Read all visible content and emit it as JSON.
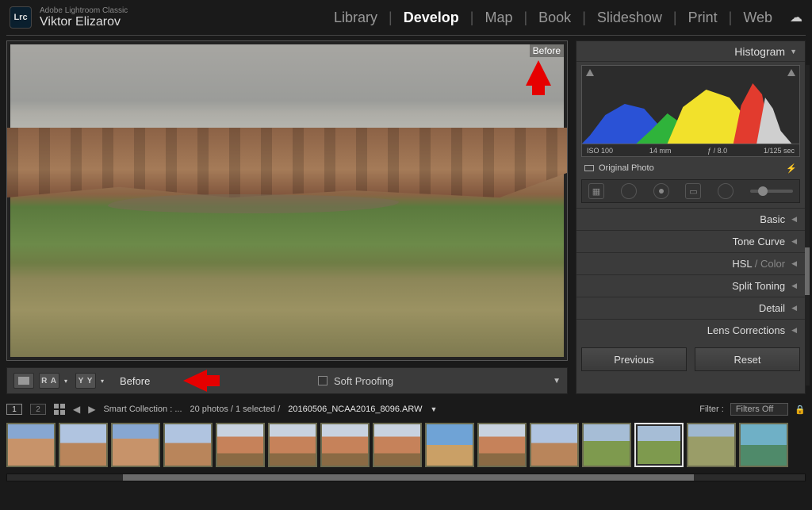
{
  "header": {
    "logo_text": "Lrc",
    "app_name": "Adobe Lightroom Classic",
    "user_name": "Viktor Elizarov",
    "modules": [
      "Library",
      "Develop",
      "Map",
      "Book",
      "Slideshow",
      "Print",
      "Web"
    ],
    "active_module": "Develop"
  },
  "preview": {
    "before_tag": "Before"
  },
  "under_toolbar": {
    "state_label": "Before",
    "soft_proof_label": "Soft Proofing"
  },
  "right_panel": {
    "histogram_label": "Histogram",
    "histo_meta": {
      "iso": "ISO 100",
      "focal": "14 mm",
      "aperture": "ƒ / 8.0",
      "shutter": "1/125 sec"
    },
    "original_label": "Original Photo",
    "panels": [
      {
        "label": "Basic"
      },
      {
        "label": "Tone Curve"
      },
      {
        "label_main": "HSL",
        "label_sub": " / Color"
      },
      {
        "label": "Split Toning"
      },
      {
        "label": "Detail"
      },
      {
        "label": "Lens Corrections"
      }
    ],
    "prev_btn": "Previous",
    "reset_btn": "Reset"
  },
  "info_row": {
    "page1": "1",
    "page2": "2",
    "collection_label": "Smart Collection : ...",
    "count_label": "20 photos / 1 selected /",
    "filename": "20160506_NCAA2016_8096.ARW",
    "filter_label": "Filter :",
    "filter_value": "Filters Off"
  },
  "filmstrip": {
    "thumbs": [
      "v1",
      "v2",
      "v1",
      "v2",
      "v3",
      "v3",
      "v3",
      "v3",
      "v4",
      "v3",
      "v2",
      "v5",
      "v5",
      "v6",
      "v7"
    ],
    "selected_index": 12
  }
}
